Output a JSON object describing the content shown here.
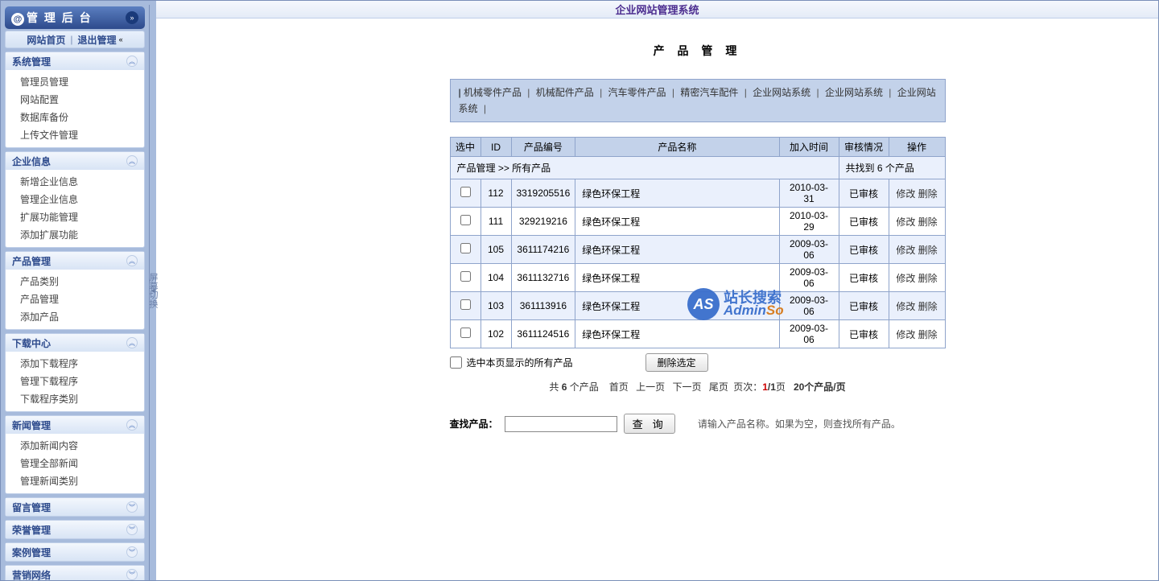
{
  "header": {
    "site_title": "企业网站管理系统"
  },
  "sidebar": {
    "brand": "管 理 后 台",
    "top_links": {
      "home": "网站首页",
      "logout": "退出管理"
    },
    "groups": [
      {
        "title": "系统管理",
        "open": true,
        "items": [
          "管理员管理",
          "网站配置",
          "数据库备份",
          "上传文件管理"
        ]
      },
      {
        "title": "企业信息",
        "open": true,
        "items": [
          "新增企业信息",
          "管理企业信息",
          "扩展功能管理",
          "添加扩展功能"
        ]
      },
      {
        "title": "产品管理",
        "open": true,
        "items": [
          "产品类别",
          "产品管理",
          "添加产品"
        ]
      },
      {
        "title": "下载中心",
        "open": true,
        "items": [
          "添加下载程序",
          "管理下载程序",
          "下载程序类别"
        ]
      },
      {
        "title": "新闻管理",
        "open": true,
        "items": [
          "添加新闻内容",
          "管理全部新闻",
          "管理新闻类别"
        ]
      },
      {
        "title": "留言管理",
        "open": false,
        "items": []
      },
      {
        "title": "荣誉管理",
        "open": false,
        "items": []
      },
      {
        "title": "案例管理",
        "open": false,
        "items": []
      },
      {
        "title": "营销网络",
        "open": false,
        "items": []
      }
    ]
  },
  "divider": {
    "label": "屏幕切换"
  },
  "page": {
    "title": "产 品 管 理",
    "categories": [
      "机械零件产品",
      "机械配件产品",
      "汽车零件产品",
      "精密汽车配件",
      "企业网站系统",
      "企业网站系统",
      "企业网站系统"
    ],
    "breadcrumb": "产品管理 >> 所有产品",
    "count_text": "共找到 6 个产品",
    "columns": [
      "选中",
      "ID",
      "产品编号",
      "产品名称",
      "加入时间",
      "审核情况",
      "操作"
    ],
    "rows": [
      {
        "id": "112",
        "code": "3319205516",
        "name": "绿色环保工程",
        "date": "2010-03-31",
        "status": "已审核"
      },
      {
        "id": "111",
        "code": "329219216",
        "name": "绿色环保工程",
        "date": "2010-03-29",
        "status": "已审核"
      },
      {
        "id": "105",
        "code": "3611174216",
        "name": "绿色环保工程",
        "date": "2009-03-06",
        "status": "已审核"
      },
      {
        "id": "104",
        "code": "3611132716",
        "name": "绿色环保工程",
        "date": "2009-03-06",
        "status": "已审核"
      },
      {
        "id": "103",
        "code": "361113916",
        "name": "绿色环保工程",
        "date": "2009-03-06",
        "status": "已审核"
      },
      {
        "id": "102",
        "code": "3611124516",
        "name": "绿色环保工程",
        "date": "2009-03-06",
        "status": "已审核"
      }
    ],
    "action_edit": "修改",
    "action_delete": "删除",
    "select_all_label": "选中本页显示的所有产品",
    "delete_selected_btn": "删除选定",
    "pagination": {
      "total_prefix": "共 ",
      "total_count": "6",
      "total_suffix": " 个产品",
      "first": "首页",
      "prev": "上一页",
      "next": "下一页",
      "last": "尾页",
      "page_label": "页次：",
      "page_cur": "1",
      "page_sep": "/",
      "page_total": "1",
      "page_unit": "页",
      "per_page": "20个产品/页"
    },
    "search": {
      "label": "查找产品：",
      "btn": "查 询",
      "hint": "请输入产品名称。如果为空，则查找所有产品。"
    }
  },
  "watermark": {
    "cn": "站长搜索",
    "en1": "Admin",
    "en2": "So"
  }
}
